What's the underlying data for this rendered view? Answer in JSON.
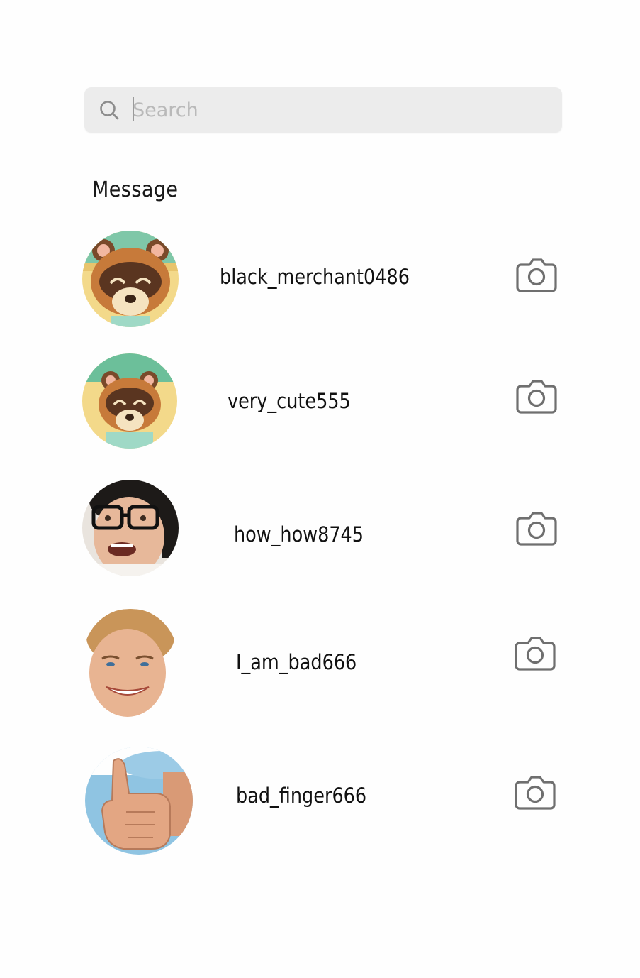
{
  "search": {
    "placeholder": "Search",
    "icon": "search-icon"
  },
  "section": {
    "title": "Message"
  },
  "conversations": [
    {
      "username": "black_merchant0486",
      "avatar": "raccoon-shopkeeper-avatar",
      "action_icon": "camera-icon"
    },
    {
      "username": "very_cute555",
      "avatar": "raccoon-shopkeeper-avatar",
      "action_icon": "camera-icon"
    },
    {
      "username": "how_how8745",
      "avatar": "man-with-glasses-avatar",
      "action_icon": "camera-icon"
    },
    {
      "username": "I_am_bad666",
      "avatar": "smiling-blond-man-avatar",
      "action_icon": "camera-icon"
    },
    {
      "username": "bad_finger666",
      "avatar": "thumbs-up-hand-avatar",
      "action_icon": "camera-icon"
    }
  ],
  "colors": {
    "background": "#fefefe",
    "search_bg": "#ececec",
    "placeholder": "#b9b9b9",
    "icon_gray": "#6f6f6f"
  }
}
